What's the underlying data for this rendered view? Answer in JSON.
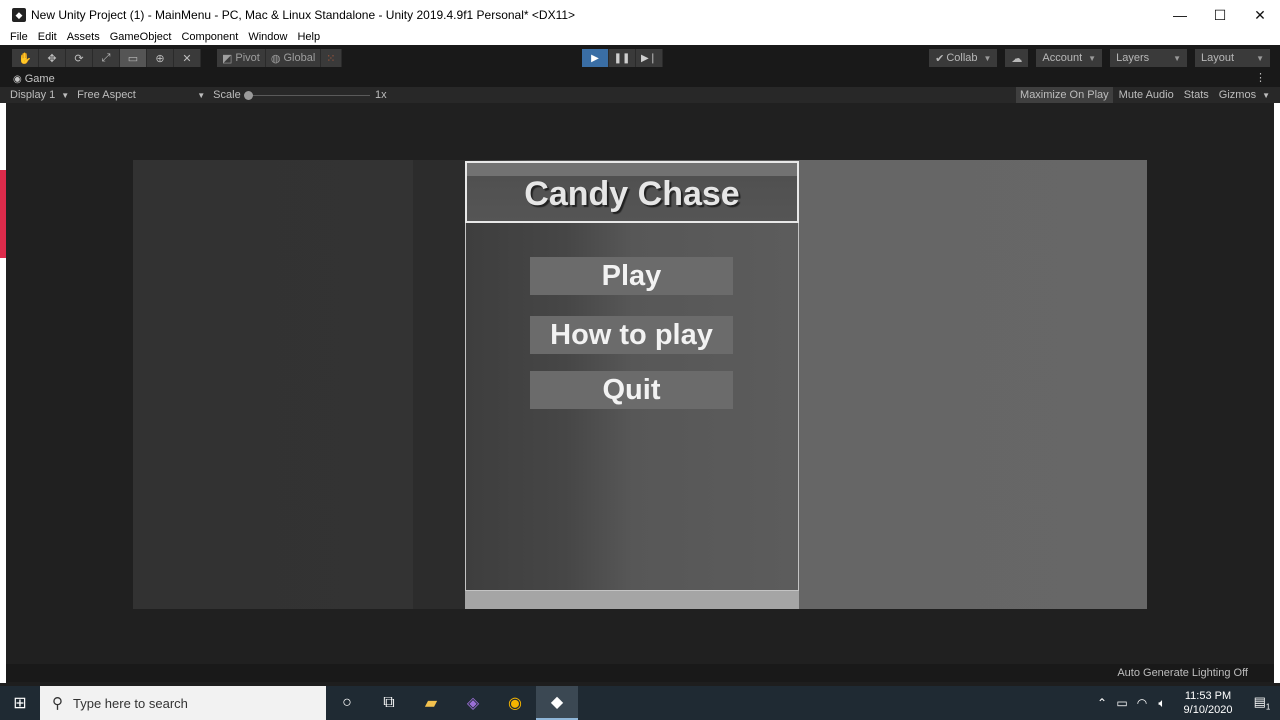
{
  "window": {
    "title": "New Unity Project (1) - MainMenu - PC, Mac & Linux Standalone - Unity 2019.4.9f1 Personal* <DX11>",
    "minimize": "—",
    "maximize": "☐",
    "close": "✕"
  },
  "menu": {
    "items": [
      "File",
      "Edit",
      "Assets",
      "GameObject",
      "Component",
      "Window",
      "Help"
    ]
  },
  "toolbar": {
    "pivot_label": "Pivot",
    "global_label": "Global",
    "collab_label": "Collab",
    "account_label": "Account",
    "layers_label": "Layers",
    "layout_label": "Layout"
  },
  "game_tab": {
    "label": "Game"
  },
  "game_bar": {
    "display": "Display 1",
    "aspect": "Free Aspect",
    "scale_label": "Scale",
    "scale_value": "1x",
    "maximize_on_play": "Maximize On Play",
    "mute_audio": "Mute Audio",
    "stats": "Stats",
    "gizmos": "Gizmos"
  },
  "game": {
    "title": "Candy Chase",
    "buttons": [
      "Play",
      "How to play",
      "Quit"
    ]
  },
  "status": {
    "lighting": "Auto Generate Lighting Off"
  },
  "taskbar": {
    "search_placeholder": "Type here to search",
    "time": "11:53 PM",
    "date": "9/10/2020",
    "notifications_count": "1"
  }
}
